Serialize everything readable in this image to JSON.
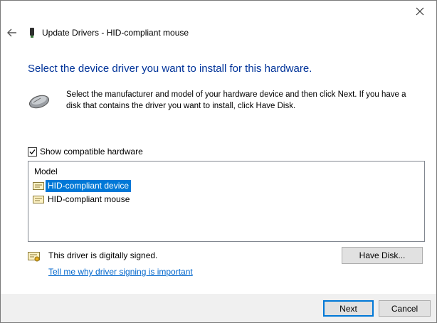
{
  "window": {
    "title": "Update Drivers - HID-compliant mouse",
    "close_icon": "close-icon",
    "back_icon": "back-arrow-icon"
  },
  "main": {
    "heading": "Select the device driver you want to install for this hardware.",
    "instruction": "Select the manufacturer and model of your hardware device and then click Next. If you have a disk that contains the driver you want to install, click Have Disk.",
    "show_compatible": {
      "label": "Show compatible hardware",
      "checked": true
    },
    "model_list": {
      "header": "Model",
      "items": [
        {
          "label": "HID-compliant device",
          "selected": true
        },
        {
          "label": "HID-compliant mouse",
          "selected": false
        }
      ]
    },
    "signed_text": "This driver is digitally signed.",
    "signing_link": "Tell me why driver signing is important",
    "have_disk_label": "Have Disk..."
  },
  "footer": {
    "next_label": "Next",
    "cancel_label": "Cancel"
  },
  "colors": {
    "heading": "#003399",
    "selection": "#0078d7",
    "link": "#0066cc"
  }
}
